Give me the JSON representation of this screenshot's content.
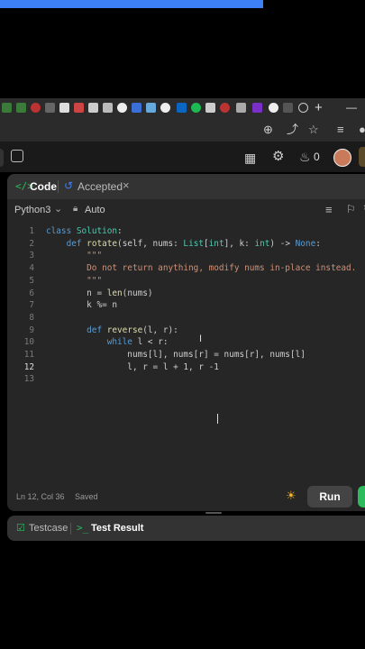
{
  "browser": {
    "tab_count": 24
  },
  "header": {
    "streak_count": "0"
  },
  "panel": {
    "code_tab_label": "Code",
    "accepted_tab_label": "Accepted",
    "language": "Python3",
    "auto_label": "Auto"
  },
  "code_lines": [
    {
      "num": "1",
      "text": "class Solution:"
    },
    {
      "num": "2",
      "text": "    def rotate(self, nums: List[int], k: int) -> None:"
    },
    {
      "num": "3",
      "text": "        \"\"\""
    },
    {
      "num": "4",
      "text": "        Do not return anything, modify nums in-place instead."
    },
    {
      "num": "5",
      "text": "        \"\"\""
    },
    {
      "num": "6",
      "text": "        n = len(nums)"
    },
    {
      "num": "7",
      "text": "        k %= n"
    },
    {
      "num": "8",
      "text": ""
    },
    {
      "num": "9",
      "text": "        def reverse(l, r):"
    },
    {
      "num": "10",
      "text": "            while l < r:"
    },
    {
      "num": "11",
      "text": "                nums[l], nums[r] = nums[r], nums[l]"
    },
    {
      "num": "12",
      "text": "                l, r = l + 1, r -1"
    },
    {
      "num": "13",
      "text": ""
    }
  ],
  "status": {
    "position": "Ln 12, Col 36",
    "saved": "Saved",
    "run_label": "Run"
  },
  "bottom": {
    "testcase_label": "Testcase",
    "test_result_label": "Test Result"
  },
  "colors": {
    "accent_blue": "#3d7ff5",
    "accepted_green": "#2cbb5d"
  }
}
